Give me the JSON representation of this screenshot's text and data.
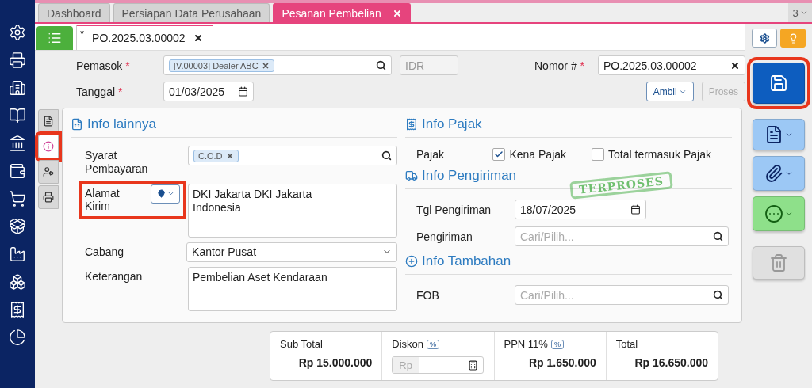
{
  "top_tabs": [
    {
      "label": "Dashboard",
      "selected": false
    },
    {
      "label": "Persiapan Data Perusahaan",
      "selected": false
    },
    {
      "label": "Pesanan Pembelian",
      "selected": true
    }
  ],
  "tab_count": "3",
  "doc_tab": {
    "label": "PO.2025.03.00002",
    "modified_mark": "*"
  },
  "header": {
    "supplier": {
      "label": "Pemasok",
      "tag": "[V.00003] Dealer ABC"
    },
    "currency": "IDR",
    "number": {
      "label": "Nomor #",
      "value": "PO.2025.03.00002"
    },
    "date": {
      "label": "Tanggal",
      "value": "01/03/2025"
    },
    "required_mark": "*",
    "buttons": [
      {
        "label": "Ambil",
        "disabled": false
      },
      {
        "label": "Proses",
        "disabled": true
      }
    ]
  },
  "side_tabs": [
    {
      "kind": "document",
      "selected": false,
      "highlighted": false
    },
    {
      "kind": "info",
      "selected": true,
      "highlighted": true
    },
    {
      "kind": "person",
      "selected": false,
      "highlighted": false
    },
    {
      "kind": "printer",
      "selected": false,
      "highlighted": false
    }
  ],
  "info_lainnya": {
    "title": "Info lainnya",
    "fields": [
      {
        "kind": "tags",
        "label": "Syarat Pembayaran",
        "tags": [
          "C.O.D"
        ],
        "highlighted": false
      },
      {
        "kind": "address",
        "label": "Alamat Kirim",
        "value": "DKI Jakarta DKI Jakarta\nIndonesia",
        "highlighted": true
      },
      {
        "kind": "select",
        "label": "Cabang",
        "value": "Kantor Pusat",
        "highlighted": false
      },
      {
        "kind": "textarea",
        "label": "Keterangan",
        "value": "Pembelian Aset Kendaraan",
        "highlighted": false
      }
    ]
  },
  "info_pajak": {
    "title": "Info Pajak",
    "label": "Pajak",
    "checks": [
      {
        "label": "Kena Pajak",
        "checked": true
      },
      {
        "label": "Total termasuk Pajak",
        "checked": false
      }
    ]
  },
  "info_pengiriman": {
    "title": "Info Pengiriman",
    "fields": [
      {
        "kind": "date",
        "label": "Tgl Pengiriman",
        "value": "18/07/2025"
      },
      {
        "kind": "search",
        "label": "Pengiriman",
        "placeholder": "Cari/Pilih..."
      }
    ]
  },
  "info_tambahan": {
    "title": "Info Tambahan",
    "fields": [
      {
        "kind": "search",
        "label": "FOB",
        "placeholder": "Cari/Pilih..."
      }
    ]
  },
  "stamp": "TERPROSES",
  "actions": [
    {
      "kind": "save",
      "highlighted": true,
      "disabled": false
    },
    {
      "kind": "document",
      "highlighted": false,
      "disabled": false
    },
    {
      "kind": "attach",
      "highlighted": false,
      "disabled": false
    },
    {
      "kind": "more",
      "highlighted": false,
      "disabled": false
    },
    {
      "kind": "delete",
      "highlighted": false,
      "disabled": true
    }
  ],
  "totals": [
    {
      "kind": "value",
      "label": "Sub Total",
      "value": "Rp 15.000.000"
    },
    {
      "kind": "input",
      "label": "Diskon",
      "badge": "%",
      "prefix": "Rp"
    },
    {
      "kind": "value",
      "label": "PPN 11%",
      "badge": "%",
      "value": "Rp 1.650.000"
    },
    {
      "kind": "value",
      "label": "Total",
      "value": "Rp 16.650.000"
    }
  ]
}
